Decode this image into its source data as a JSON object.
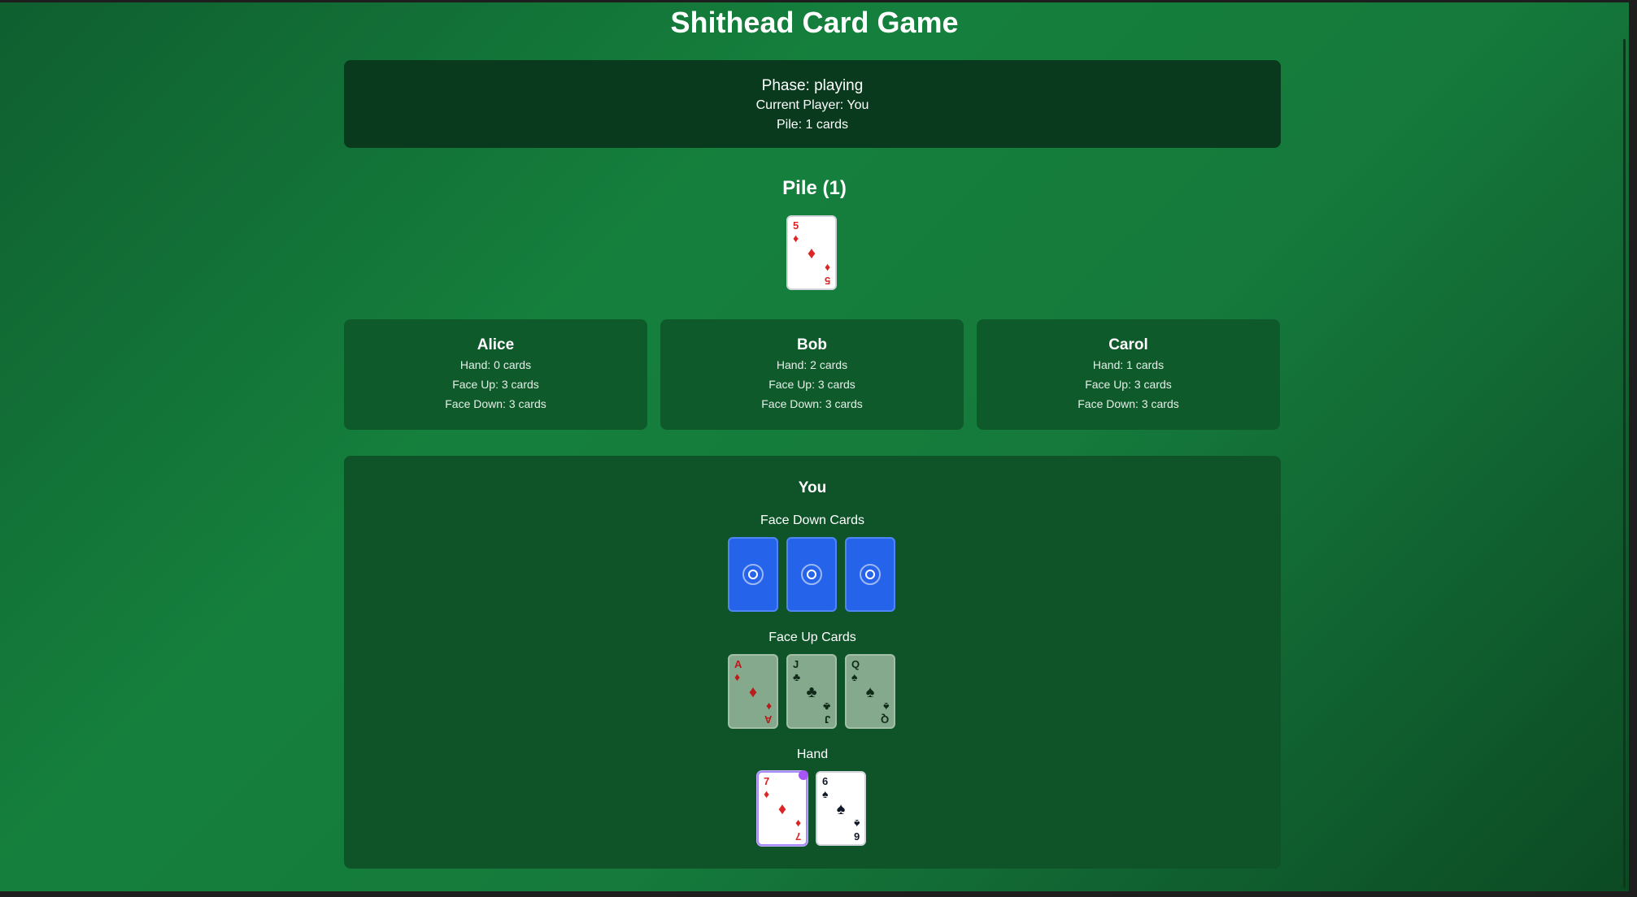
{
  "title": "Shithead Card Game",
  "status": {
    "phase": "Phase: playing",
    "current_player": "Current Player: You",
    "pile": "Pile: 1 cards"
  },
  "pile": {
    "title": "Pile (1)",
    "top_card": {
      "rank": "5",
      "suit": "♦",
      "color": "red"
    }
  },
  "opponents": [
    {
      "name": "Alice",
      "hand": "Hand: 0 cards",
      "face_up": "Face Up: 3 cards",
      "face_down": "Face Down: 3 cards"
    },
    {
      "name": "Bob",
      "hand": "Hand: 2 cards",
      "face_up": "Face Up: 3 cards",
      "face_down": "Face Down: 3 cards"
    },
    {
      "name": "Carol",
      "hand": "Hand: 1 cards",
      "face_up": "Face Up: 3 cards",
      "face_down": "Face Down: 3 cards"
    }
  ],
  "player": {
    "name": "You",
    "face_down_label": "Face Down Cards",
    "face_up_label": "Face Up Cards",
    "hand_label": "Hand",
    "face_up_cards": [
      {
        "rank": "A",
        "suit": "♦",
        "color": "red"
      },
      {
        "rank": "J",
        "suit": "♣",
        "color": "black"
      },
      {
        "rank": "Q",
        "suit": "♠",
        "color": "black"
      }
    ],
    "hand_cards": [
      {
        "rank": "7",
        "suit": "♦",
        "color": "red",
        "selected": true
      },
      {
        "rank": "6",
        "suit": "♠",
        "color": "black",
        "selected": false
      }
    ]
  },
  "colors": {
    "selection": "#a855f7",
    "card_back": "#2563eb",
    "red_suit": "#dc2626"
  }
}
